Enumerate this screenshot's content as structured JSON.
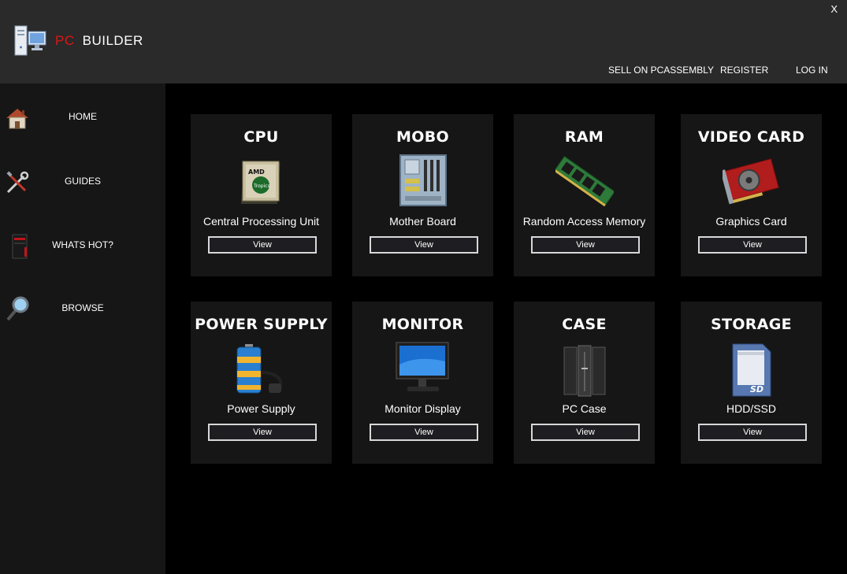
{
  "window": {
    "close_label": "X"
  },
  "logo": {
    "pc": "PC",
    "builder": "BUILDER"
  },
  "topnav": {
    "sell": "SELL ON PCASSEMBLY",
    "register": "REGISTER",
    "login": "LOG IN"
  },
  "sidebar": {
    "items": [
      {
        "label": "HOME",
        "icon": "house-icon"
      },
      {
        "label": "GUIDES",
        "icon": "tools-icon"
      },
      {
        "label": "WHATS HOT?",
        "icon": "pc-tower-icon"
      },
      {
        "label": "BROWSE",
        "icon": "magnifier-icon"
      }
    ]
  },
  "cards": [
    {
      "title": "CPU",
      "subtitle": "Central Processing Unit",
      "button": "View",
      "icon": "cpu-chip-icon",
      "chip_brand": "AMD",
      "chip_model": "Tropics"
    },
    {
      "title": "MOBO",
      "subtitle": "Mother Board",
      "button": "View",
      "icon": "motherboard-icon"
    },
    {
      "title": "RAM",
      "subtitle": "Random Access Memory",
      "button": "View",
      "icon": "ram-stick-icon"
    },
    {
      "title": "VIDEO CARD",
      "subtitle": "Graphics Card",
      "button": "View",
      "icon": "graphics-card-icon"
    },
    {
      "title": "POWER SUPPLY",
      "subtitle": "Power Supply",
      "button": "View",
      "icon": "battery-plug-icon"
    },
    {
      "title": "MONITOR",
      "subtitle": "Monitor Display",
      "button": "View",
      "icon": "monitor-icon"
    },
    {
      "title": "CASE",
      "subtitle": "PC Case",
      "button": "View",
      "icon": "server-case-icon"
    },
    {
      "title": "STORAGE",
      "subtitle": "HDD/SSD",
      "button": "View",
      "icon": "sd-card-icon",
      "card_text": "SD"
    }
  ]
}
